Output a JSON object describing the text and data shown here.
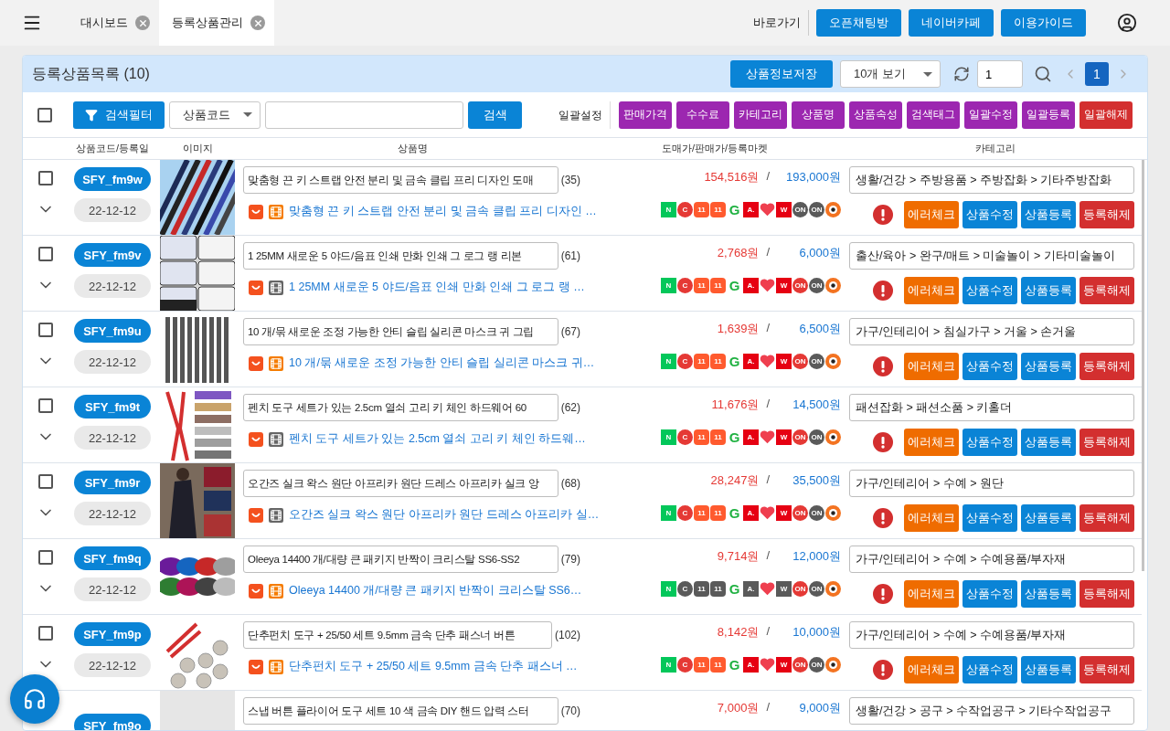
{
  "topbar": {
    "tabs": [
      {
        "label": "대시보드",
        "selected": false
      },
      {
        "label": "등록상품관리",
        "selected": true
      }
    ],
    "shortcut_label": "바로가기",
    "links": [
      "오픈채팅방",
      "네이버카페",
      "이용가이드"
    ]
  },
  "panel": {
    "title": "등록상품목록 (10)",
    "save_button": "상품정보저장",
    "page_size": "10개 보기",
    "page_input": "1",
    "pages": [
      {
        "label": "1",
        "selected": true
      }
    ]
  },
  "toolbar": {
    "select_all": {
      "checked": false
    },
    "filter_button": "검색필터",
    "search_type": "상품코드",
    "search_button": "검색",
    "bulk_label": "일괄설정",
    "bulk_buttons": [
      {
        "label": "판매가격",
        "kind": "set"
      },
      {
        "label": "수수료",
        "kind": "set"
      },
      {
        "label": "카테고리",
        "kind": "set"
      },
      {
        "label": "상품명",
        "kind": "set"
      },
      {
        "label": "상품속성",
        "kind": "set"
      },
      {
        "label": "검색태그",
        "kind": "set"
      },
      {
        "label": "일괄수정",
        "kind": "set"
      },
      {
        "label": "일괄등록",
        "kind": "set"
      },
      {
        "label": "일괄해제",
        "kind": "reset"
      }
    ]
  },
  "columns": [
    "상품코드/등록일",
    "이미지",
    "상품명",
    "도매가/판매가/등록마켓",
    "카테고리"
  ],
  "rows": [
    {
      "checked": false,
      "code": "SFY_fm9w",
      "date": "22-12-12",
      "image": {
        "kind": "picture"
      },
      "title": "맞춤형 끈 키 스트랩 안전 분리 및 금속 클립 프리 디자인 도매",
      "count": "(35)",
      "video": true,
      "link": "맞춤형 끈 키 스트랩 안전 분리 및 금속 클립 프리 디자인 …",
      "wholesale": "154,516원",
      "separator": "/",
      "price": "193,000원",
      "category": "생활/건강 > 주방용품 > 주방잡화 > 기타주방잡화",
      "markets": [
        {
          "kind": "greenbox",
          "label": "N",
          "active": true
        },
        {
          "kind": "redcircle",
          "label": "C",
          "active": true
        },
        {
          "kind": "orangetile",
          "label": "11",
          "active": true
        },
        {
          "kind": "orangetile",
          "label": "11",
          "active": true
        },
        {
          "kind": "greenletter",
          "label": "G",
          "active": true
        },
        {
          "kind": "redbox",
          "label": "A.",
          "active": true
        },
        {
          "kind": "heart",
          "active": true
        },
        {
          "kind": "redbox",
          "label": "W",
          "active": true
        },
        {
          "kind": "redcircle",
          "label": "ON",
          "active": false
        },
        {
          "kind": "redcircle",
          "label": "ON",
          "active": false
        },
        {
          "kind": "ring",
          "active": true
        }
      ],
      "actions": [
        {
          "label": "에러체크",
          "kind": "check"
        },
        {
          "label": "상품수정",
          "kind": "edit"
        },
        {
          "label": "상품등록",
          "kind": "edit"
        },
        {
          "label": "등록해제",
          "kind": "remove"
        }
      ]
    },
    {
      "checked": false,
      "code": "SFY_fm9v",
      "date": "22-12-12",
      "image": {
        "kind": "picture"
      },
      "title": "1 25MM 새로운 5 야드/음표 인쇄 만화 인쇄 그 로그 랭 리본",
      "count": "(61)",
      "video": false,
      "link": "1 25MM 새로운 5 야드/음표 인쇄 만화 인쇄 그 로그 랭 …",
      "wholesale": "2,768원",
      "separator": "/",
      "price": "6,000원",
      "category": "출산/육아 > 완구/매트 > 미술놀이 > 기타미술놀이",
      "markets": [
        {
          "kind": "greenbox",
          "label": "N",
          "active": true
        },
        {
          "kind": "redcircle",
          "label": "C",
          "active": true
        },
        {
          "kind": "orangetile",
          "label": "11",
          "active": true
        },
        {
          "kind": "orangetile",
          "label": "11",
          "active": true
        },
        {
          "kind": "greenletter",
          "label": "G",
          "active": true
        },
        {
          "kind": "redbox",
          "label": "A.",
          "active": true
        },
        {
          "kind": "heart",
          "active": true
        },
        {
          "kind": "redbox",
          "label": "W",
          "active": true
        },
        {
          "kind": "redcircle",
          "label": "ON",
          "active": true
        },
        {
          "kind": "redcircle",
          "label": "ON",
          "active": false
        },
        {
          "kind": "ring",
          "active": true
        }
      ],
      "actions": [
        {
          "label": "에러체크",
          "kind": "check"
        },
        {
          "label": "상품수정",
          "kind": "edit"
        },
        {
          "label": "상품등록",
          "kind": "edit"
        },
        {
          "label": "등록해제",
          "kind": "remove"
        }
      ]
    },
    {
      "checked": false,
      "code": "SFY_fm9u",
      "date": "22-12-12",
      "image": {
        "kind": "picture"
      },
      "title": "10 개/묶 새로운 조정 가능한 안티 슬립 실리콘 마스크 귀 그립",
      "count": "(67)",
      "video": true,
      "link": "10 개/묶 새로운 조정 가능한 안티 슬립 실리콘 마스크 귀…",
      "wholesale": "1,639원",
      "separator": "/",
      "price": "6,500원",
      "category": "가구/인테리어 > 침실가구 > 거울 > 손거울",
      "markets": [
        {
          "kind": "greenbox",
          "label": "N",
          "active": true
        },
        {
          "kind": "redcircle",
          "label": "C",
          "active": true
        },
        {
          "kind": "orangetile",
          "label": "11",
          "active": true
        },
        {
          "kind": "orangetile",
          "label": "11",
          "active": true
        },
        {
          "kind": "greenletter",
          "label": "G",
          "active": true
        },
        {
          "kind": "redbox",
          "label": "A.",
          "active": true
        },
        {
          "kind": "heart",
          "active": true
        },
        {
          "kind": "redbox",
          "label": "W",
          "active": true
        },
        {
          "kind": "redcircle",
          "label": "ON",
          "active": true
        },
        {
          "kind": "redcircle",
          "label": "ON",
          "active": false
        },
        {
          "kind": "ring",
          "active": true
        }
      ],
      "actions": [
        {
          "label": "에러체크",
          "kind": "check"
        },
        {
          "label": "상품수정",
          "kind": "edit"
        },
        {
          "label": "상품등록",
          "kind": "edit"
        },
        {
          "label": "등록해제",
          "kind": "remove"
        }
      ]
    },
    {
      "checked": false,
      "code": "SFY_fm9t",
      "date": "22-12-12",
      "image": {
        "kind": "picture"
      },
      "title": "펜치 도구 세트가 있는 2.5cm 열쇠 고리 키 체인 하드웨어 60",
      "count": "(62)",
      "video": false,
      "link": "펜치 도구 세트가 있는 2.5cm 열쇠 고리 키 체인 하드웨…",
      "wholesale": "11,676원",
      "separator": "/",
      "price": "14,500원",
      "category": "패션잡화 > 패션소품 > 키홀더",
      "markets": [
        {
          "kind": "greenbox",
          "label": "N",
          "active": true
        },
        {
          "kind": "redcircle",
          "label": "C",
          "active": true
        },
        {
          "kind": "orangetile",
          "label": "11",
          "active": true
        },
        {
          "kind": "orangetile",
          "label": "11",
          "active": true
        },
        {
          "kind": "greenletter",
          "label": "G",
          "active": true
        },
        {
          "kind": "redbox",
          "label": "A.",
          "active": true
        },
        {
          "kind": "heart",
          "active": true
        },
        {
          "kind": "redbox",
          "label": "W",
          "active": true
        },
        {
          "kind": "redcircle",
          "label": "ON",
          "active": true
        },
        {
          "kind": "redcircle",
          "label": "ON",
          "active": false
        },
        {
          "kind": "ring",
          "active": true
        }
      ],
      "actions": [
        {
          "label": "에러체크",
          "kind": "check"
        },
        {
          "label": "상품수정",
          "kind": "edit"
        },
        {
          "label": "상품등록",
          "kind": "edit"
        },
        {
          "label": "등록해제",
          "kind": "remove"
        }
      ]
    },
    {
      "checked": false,
      "code": "SFY_fm9r",
      "date": "22-12-12",
      "image": {
        "kind": "picture"
      },
      "title": "오간즈 실크 왁스 원단 아프리카 원단 드레스 아프리카 실크 앙",
      "count": "(68)",
      "video": false,
      "link": "오간즈 실크 왁스 원단 아프리카 원단 드레스 아프리카 실…",
      "wholesale": "28,247원",
      "separator": "/",
      "price": "35,500원",
      "category": "가구/인테리어 > 수예 > 원단",
      "markets": [
        {
          "kind": "greenbox",
          "label": "N",
          "active": true
        },
        {
          "kind": "redcircle",
          "label": "C",
          "active": true
        },
        {
          "kind": "orangetile",
          "label": "11",
          "active": true
        },
        {
          "kind": "orangetile",
          "label": "11",
          "active": true
        },
        {
          "kind": "greenletter",
          "label": "G",
          "active": true
        },
        {
          "kind": "redbox",
          "label": "A.",
          "active": true
        },
        {
          "kind": "heart",
          "active": true
        },
        {
          "kind": "redbox",
          "label": "W",
          "active": true
        },
        {
          "kind": "redcircle",
          "label": "ON",
          "active": true
        },
        {
          "kind": "redcircle",
          "label": "ON",
          "active": false
        },
        {
          "kind": "ring",
          "active": true
        }
      ],
      "actions": [
        {
          "label": "에러체크",
          "kind": "check"
        },
        {
          "label": "상품수정",
          "kind": "edit"
        },
        {
          "label": "상품등록",
          "kind": "edit"
        },
        {
          "label": "등록해제",
          "kind": "remove"
        }
      ]
    },
    {
      "checked": false,
      "code": "SFY_fm9q",
      "date": "22-12-12",
      "image": {
        "kind": "picture"
      },
      "title": "Oleeya 14400 개/대량 큰 패키지 반짝이 크리스탈 SS6-SS2",
      "count": "(79)",
      "video": true,
      "link": "Oleeya 14400 개/대량 큰 패키지 반짝이 크리스탈 SS6…",
      "wholesale": "9,714원",
      "separator": "/",
      "price": "12,000원",
      "category": "가구/인테리어 > 수예 > 수예용품/부자재",
      "markets": [
        {
          "kind": "greenbox",
          "label": "N",
          "active": true
        },
        {
          "kind": "redcircle",
          "label": "C",
          "active": false
        },
        {
          "kind": "orangetile",
          "label": "11",
          "active": false
        },
        {
          "kind": "orangetile",
          "label": "11",
          "active": false
        },
        {
          "kind": "greenletter",
          "label": "G",
          "active": true
        },
        {
          "kind": "redbox",
          "label": "A.",
          "active": false
        },
        {
          "kind": "heart",
          "active": true
        },
        {
          "kind": "redbox",
          "label": "W",
          "active": false
        },
        {
          "kind": "redcircle",
          "label": "ON",
          "active": true
        },
        {
          "kind": "redcircle",
          "label": "ON",
          "active": false
        },
        {
          "kind": "ring",
          "active": true
        }
      ],
      "actions": [
        {
          "label": "에러체크",
          "kind": "check"
        },
        {
          "label": "상품수정",
          "kind": "edit"
        },
        {
          "label": "상품등록",
          "kind": "edit"
        },
        {
          "label": "등록해제",
          "kind": "remove"
        }
      ]
    },
    {
      "checked": false,
      "code": "SFY_fm9p",
      "date": "22-12-12",
      "image": {
        "kind": "picture"
      },
      "title": "단추펀치 도구 + 25/50 세트 9.5mm 금속 단추 패스너 버튼",
      "count": "(102)",
      "video": true,
      "link": "단추펀치 도구 + 25/50 세트 9.5mm 금속 단추 패스너 …",
      "wholesale": "8,142원",
      "separator": "/",
      "price": "10,000원",
      "category": "가구/인테리어 > 수예 > 수예용품/부자재",
      "markets": [
        {
          "kind": "greenbox",
          "label": "N",
          "active": true
        },
        {
          "kind": "redcircle",
          "label": "C",
          "active": true
        },
        {
          "kind": "orangetile",
          "label": "11",
          "active": true
        },
        {
          "kind": "orangetile",
          "label": "11",
          "active": true
        },
        {
          "kind": "greenletter",
          "label": "G",
          "active": true
        },
        {
          "kind": "redbox",
          "label": "A.",
          "active": true
        },
        {
          "kind": "heart",
          "active": true
        },
        {
          "kind": "redbox",
          "label": "W",
          "active": true
        },
        {
          "kind": "redcircle",
          "label": "ON",
          "active": true
        },
        {
          "kind": "redcircle",
          "label": "ON",
          "active": false
        },
        {
          "kind": "ring",
          "active": true
        }
      ],
      "actions": [
        {
          "label": "에러체크",
          "kind": "check"
        },
        {
          "label": "상품수정",
          "kind": "edit"
        },
        {
          "label": "상품등록",
          "kind": "edit"
        },
        {
          "label": "등록해제",
          "kind": "remove"
        }
      ]
    },
    {
      "code": "SFY_fm9o",
      "image": {
        "kind": "empty"
      },
      "title": "스냅 버튼 플라이어 도구 세트 10 색 금속 DIY 핸드 압력 스터",
      "count": "(70)",
      "wholesale": "7,000원",
      "separator": "/",
      "price": "9,000원",
      "category": "생활/건강 > 공구 > 수작업공구 > 기타수작업공구"
    }
  ]
}
